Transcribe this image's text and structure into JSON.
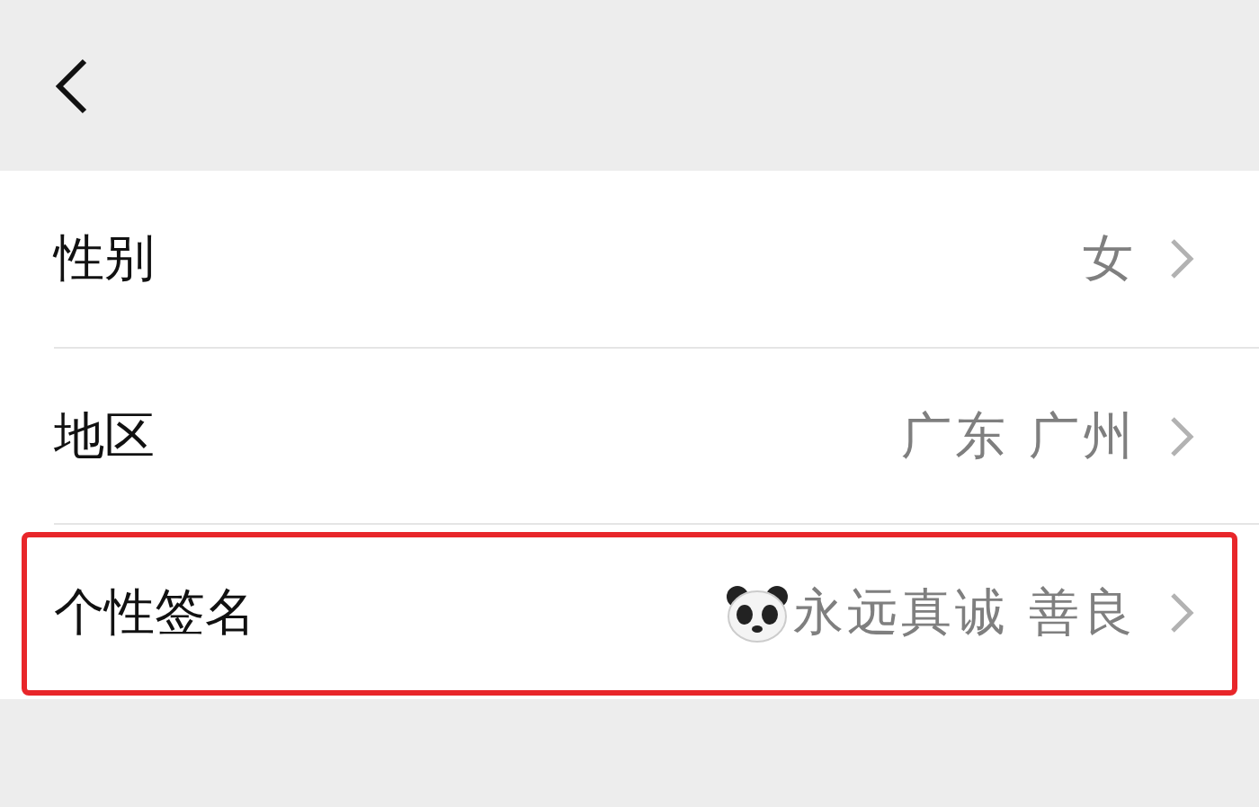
{
  "rows": [
    {
      "kind": "plain",
      "label": "性别",
      "value": "女",
      "highlighted": false
    },
    {
      "kind": "plain",
      "label": "地区",
      "value": "广东 广州",
      "highlighted": false
    },
    {
      "kind": "emoji-prefix",
      "label": "个性签名",
      "value": "永远真诚 善良",
      "highlighted": true
    }
  ]
}
